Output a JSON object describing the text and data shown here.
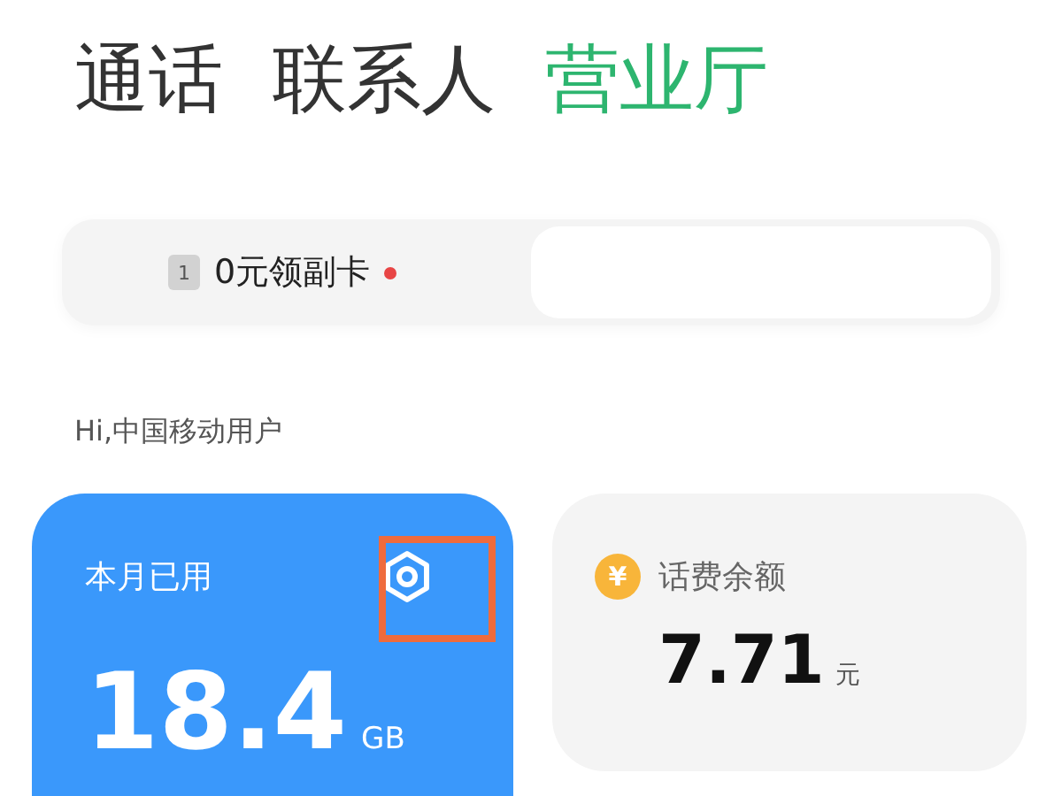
{
  "tabs": [
    {
      "label": "通话",
      "selected": false
    },
    {
      "label": "联系人",
      "selected": false
    },
    {
      "label": "营业厅",
      "selected": true
    }
  ],
  "promo_banner": {
    "badge": "1",
    "text": "0元领副卡",
    "unread": true
  },
  "greeting": "Hi,中国移动用户",
  "data_card": {
    "title": "本月已用",
    "value": "18.4",
    "unit": "GB",
    "highlighted": true
  },
  "balance_card": {
    "title": "话费余额",
    "icon": "¥",
    "value": "7.71",
    "unit": "元"
  }
}
